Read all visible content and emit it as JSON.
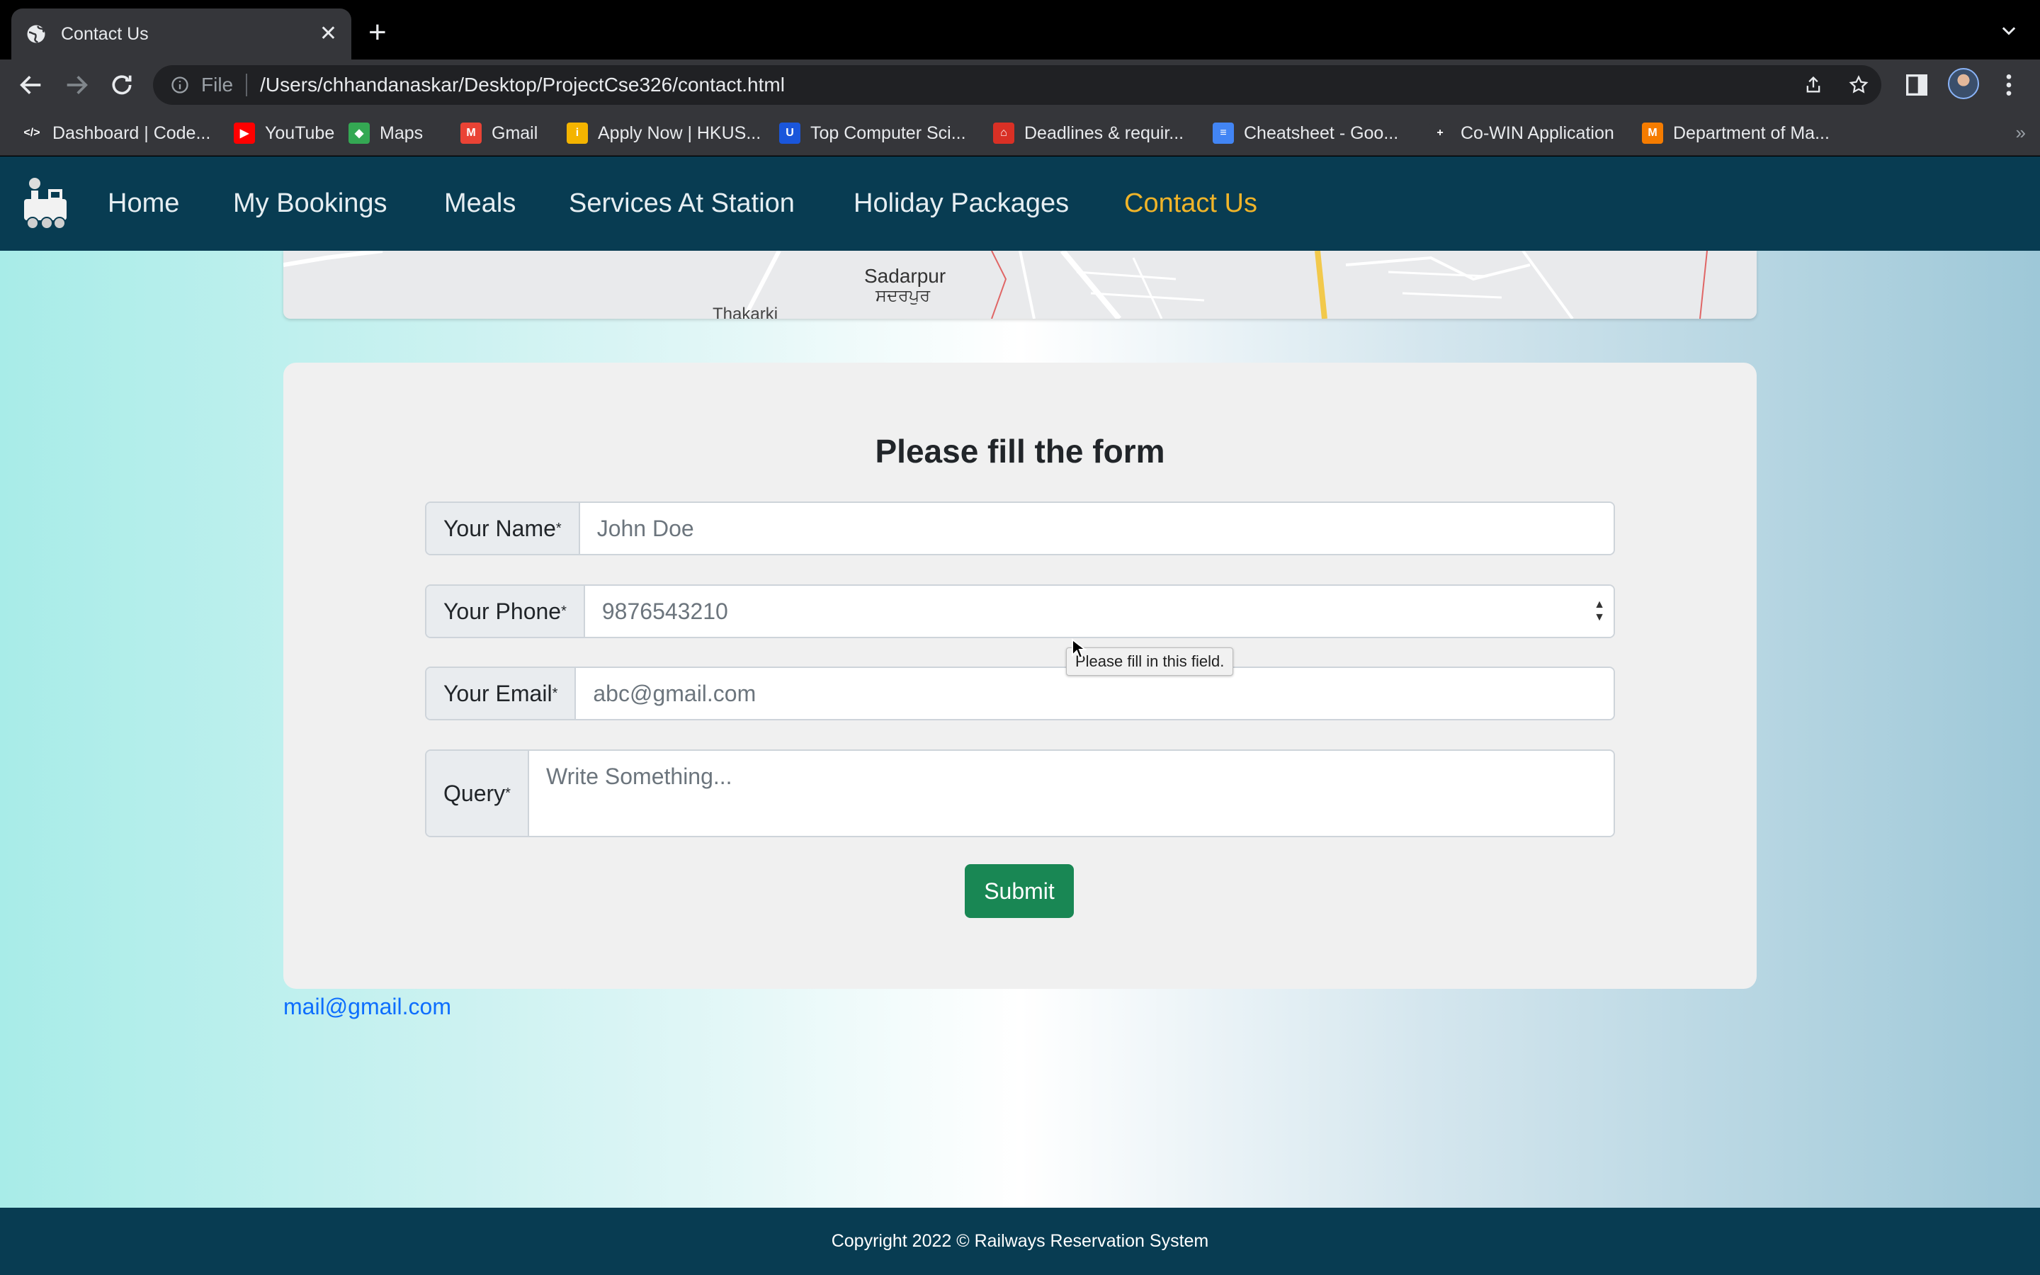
{
  "browser": {
    "tab_title": "Contact Us",
    "omnibox_scheme": "File",
    "url": "/Users/chhandanaskar/Desktop/ProjectCse326/contact.html",
    "bookmarks": [
      {
        "label": "Dashboard | Code...",
        "icon": "code-icon",
        "color": "#35363a"
      },
      {
        "label": "YouTube",
        "icon": "youtube-icon",
        "color": "#ff0000"
      },
      {
        "label": "Maps",
        "icon": "maps-icon",
        "color": "#34a853"
      },
      {
        "label": "Gmail",
        "icon": "gmail-icon",
        "color": "#ea4335"
      },
      {
        "label": "Apply Now | HKUS...",
        "icon": "info-icon",
        "color": "#f4b400"
      },
      {
        "label": "Top Computer Sci...",
        "icon": "usn-icon",
        "color": "#1a56db"
      },
      {
        "label": "Deadlines & requir...",
        "icon": "university-icon",
        "color": "#d93025"
      },
      {
        "label": "Cheatsheet - Goo...",
        "icon": "docs-icon",
        "color": "#4285f4"
      },
      {
        "label": "Co-WIN Application",
        "icon": "cowin-icon",
        "color": "#35363a"
      },
      {
        "label": "Department of Ma...",
        "icon": "iit-icon",
        "color": "#f57c00"
      }
    ]
  },
  "nav": {
    "items": [
      "Home",
      "My Bookings",
      "Meals",
      "Services At Station",
      "Holiday Packages",
      "Contact Us"
    ],
    "active": "Contact Us",
    "accent": "#f0b429"
  },
  "map": {
    "place": "Sadarpur",
    "place_local": "ਸਦਰਪੁਰ",
    "place_left": "Thakarki"
  },
  "form": {
    "title": "Please fill the form",
    "name_label": "Your Name",
    "name_placeholder": "John Doe",
    "phone_label": "Your Phone",
    "phone_placeholder": "9876543210",
    "email_label": "Your Email",
    "email_placeholder": "abc@gmail.com",
    "query_label": "Query",
    "query_placeholder": "Write Something...",
    "required_mark": "*",
    "submit_label": "Submit",
    "tooltip": "Please fill in this field."
  },
  "contact_email": "mail@gmail.com",
  "footer": "Copyright 2022 © Railways Reservation System",
  "colors": {
    "navbar": "#083c52",
    "submit": "#198754",
    "link": "#0d6efd"
  }
}
